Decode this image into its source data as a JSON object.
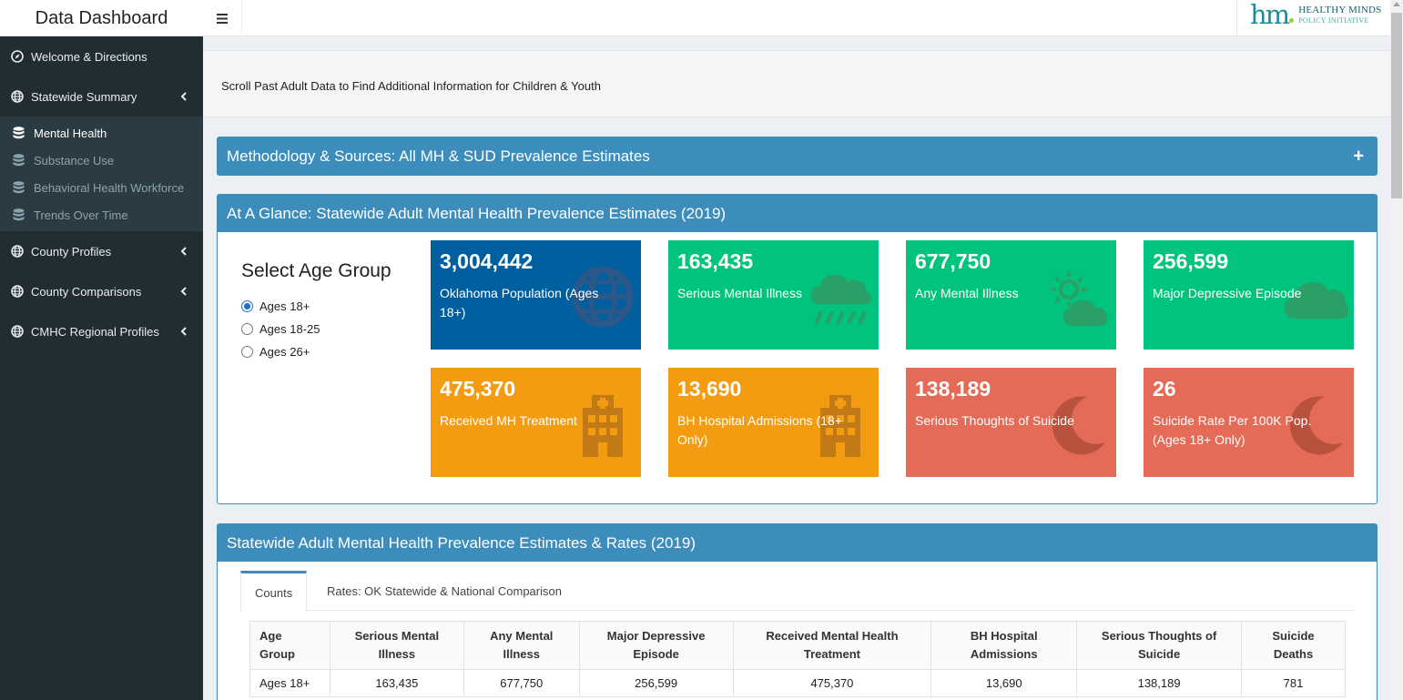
{
  "header": {
    "title": "Data Dashboard",
    "logo": {
      "mark": "hm",
      "line1": "HEALTHY MINDS",
      "line2": "POLICY INITIATIVE"
    }
  },
  "sidebar": {
    "items": [
      {
        "label": "Welcome & Directions",
        "icon": "compass-icon"
      },
      {
        "label": "Statewide Summary",
        "icon": "globe-icon",
        "expanded": true
      },
      {
        "label": "County Profiles",
        "icon": "globe-icon"
      },
      {
        "label": "County Comparisons",
        "icon": "globe-icon"
      },
      {
        "label": "CMHC Regional Profiles",
        "icon": "globe-icon"
      }
    ],
    "submenu": [
      {
        "label": "Mental Health",
        "icon": "database-icon",
        "active": true
      },
      {
        "label": "Substance Use",
        "icon": "database-icon"
      },
      {
        "label": "Behavioral Health Workforce",
        "icon": "database-icon"
      },
      {
        "label": "Trends Over Time",
        "icon": "database-icon"
      }
    ]
  },
  "notice": "Scroll Past Adult Data to Find Additional Information for Children & Youth",
  "methodology": {
    "title": "Methodology & Sources: All MH & SUD Prevalence Estimates",
    "toggle": "+"
  },
  "glance": {
    "title": "At A Glance: Statewide Adult Mental Health Prevalence Estimates (2019)",
    "select_title": "Select Age Group",
    "age_options": [
      {
        "label": "Ages 18+",
        "checked": true
      },
      {
        "label": "Ages 18-25",
        "checked": false
      },
      {
        "label": "Ages 26+",
        "checked": false
      }
    ],
    "value_boxes": [
      {
        "value": "3,004,442",
        "label": "Oklahoma Population (Ages 18+)",
        "color": "#005f9e",
        "icon": "globe-icon"
      },
      {
        "value": "163,435",
        "label": "Serious Mental Illness",
        "color": "#00c47d",
        "icon": "cloud-rain-icon"
      },
      {
        "value": "677,750",
        "label": "Any Mental Illness",
        "color": "#00c47d",
        "icon": "cloud-sun-icon"
      },
      {
        "value": "256,599",
        "label": "Major Depressive Episode",
        "color": "#00c47d",
        "icon": "cloud-icon"
      },
      {
        "value": "475,370",
        "label": "Received MH Treatment",
        "color": "#f39c12",
        "icon": "hospital-icon"
      },
      {
        "value": "13,690",
        "label": "BH Hospital Admissions (18+ Only)",
        "color": "#f39c12",
        "icon": "hospital-icon"
      },
      {
        "value": "138,189",
        "label": "Serious Thoughts of Suicide",
        "color": "#e46b57",
        "icon": "moon-icon"
      },
      {
        "value": "26",
        "label": "Suicide Rate Per 100K Pop. (Ages 18+ Only)",
        "color": "#e46b57",
        "icon": "moon-icon"
      }
    ]
  },
  "estimates": {
    "title": "Statewide Adult Mental Health Prevalence Estimates & Rates (2019)",
    "tabs": [
      {
        "label": "Counts",
        "active": true
      },
      {
        "label": "Rates: OK Statewide & National Comparison",
        "active": false
      }
    ],
    "table": {
      "headers": [
        "Age Group",
        "Serious Mental Illness",
        "Any Mental Illness",
        "Major Depressive Episode",
        "Received Mental Health Treatment",
        "BH Hospital Admissions",
        "Serious Thoughts of Suicide",
        "Suicide Deaths"
      ],
      "rows": [
        [
          "Ages 18+",
          "163,435",
          "677,750",
          "256,599",
          "475,370",
          "13,690",
          "138,189",
          "781"
        ]
      ]
    }
  }
}
